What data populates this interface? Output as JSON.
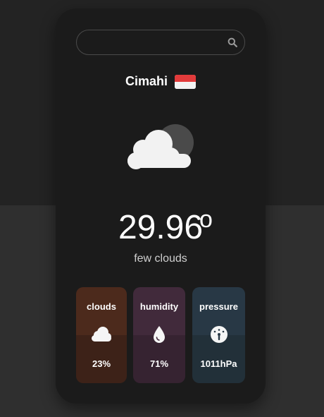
{
  "search": {
    "placeholder": "",
    "value": ""
  },
  "location": {
    "city": "Cimahi",
    "flag": "indonesia-flag"
  },
  "current": {
    "temperature": "29.96",
    "unit": "o",
    "description": "few clouds",
    "icon": "cloud-over-moon-icon"
  },
  "stats": [
    {
      "label": "clouds",
      "value": "23%",
      "icon": "cloud-icon"
    },
    {
      "label": "humidity",
      "value": "71%",
      "icon": "droplet-icon"
    },
    {
      "label": "pressure",
      "value": "1011hPa",
      "icon": "gauge-icon"
    }
  ],
  "colors": {
    "card": "#1b1b1b",
    "clouds_tile": "#4c2a1c",
    "humidity_tile": "#412a3b",
    "pressure_tile": "#283845"
  }
}
